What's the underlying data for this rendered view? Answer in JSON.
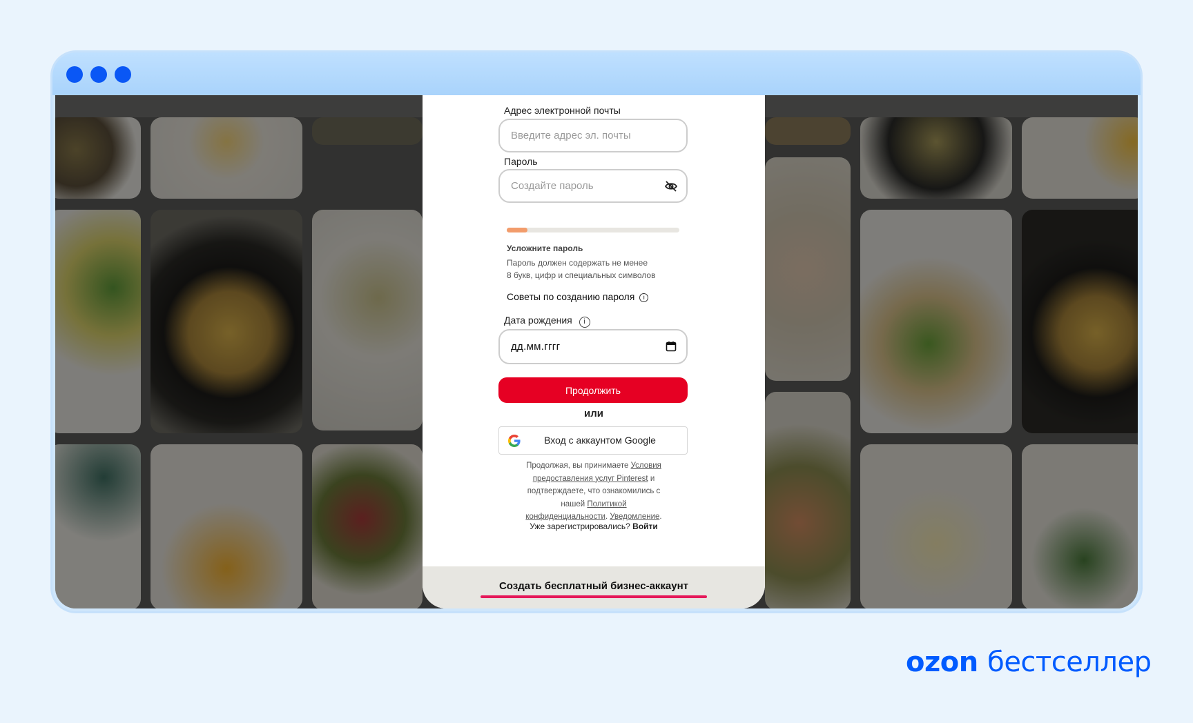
{
  "window": {
    "controls": [
      "close",
      "minimize",
      "maximize"
    ]
  },
  "form": {
    "email": {
      "label": "Адрес электронной почты",
      "placeholder": "Введите адрес эл. почты"
    },
    "password": {
      "label": "Пароль",
      "placeholder": "Создайте пароль",
      "toggle_icon": "eye-off-icon"
    },
    "strength": {
      "level": 0.12,
      "color": "#f29c6b",
      "title": "Усложните пароль",
      "hint_line1": "Пароль должен содержать не менее",
      "hint_line2": "8 букв, цифр и специальных символов"
    },
    "tips_label": "Советы по созданию пароля",
    "birthdate": {
      "label": "Дата рождения",
      "value": "дд.мм.гггг"
    },
    "continue_label": "Продолжить",
    "or_label": "или",
    "google_label": "Вход с аккаунтом Google",
    "terms": {
      "t1": "Продолжая, вы принимаете",
      "link_terms_a": "Условия",
      "link_terms_b": "предоставления услуг Pinterest",
      "t2": "и",
      "t3": "подтверждаете, что ознакомились с",
      "t4": "нашей",
      "link_privacy_a": "Политикой",
      "link_privacy_b": "конфиденциальности",
      "link_notice": "Уведомление"
    },
    "already_text": "Уже зарегистрировались?",
    "login_link": "Войти",
    "business_label": "Создать бесплатный бизнес-аккаунт"
  },
  "brand": {
    "name": "ozon",
    "suffix": "бестселлер",
    "color": "#005bff"
  },
  "colors": {
    "accent_red": "#e60023",
    "underline": "#e5195a",
    "page_bg": "#eaf4fd"
  }
}
